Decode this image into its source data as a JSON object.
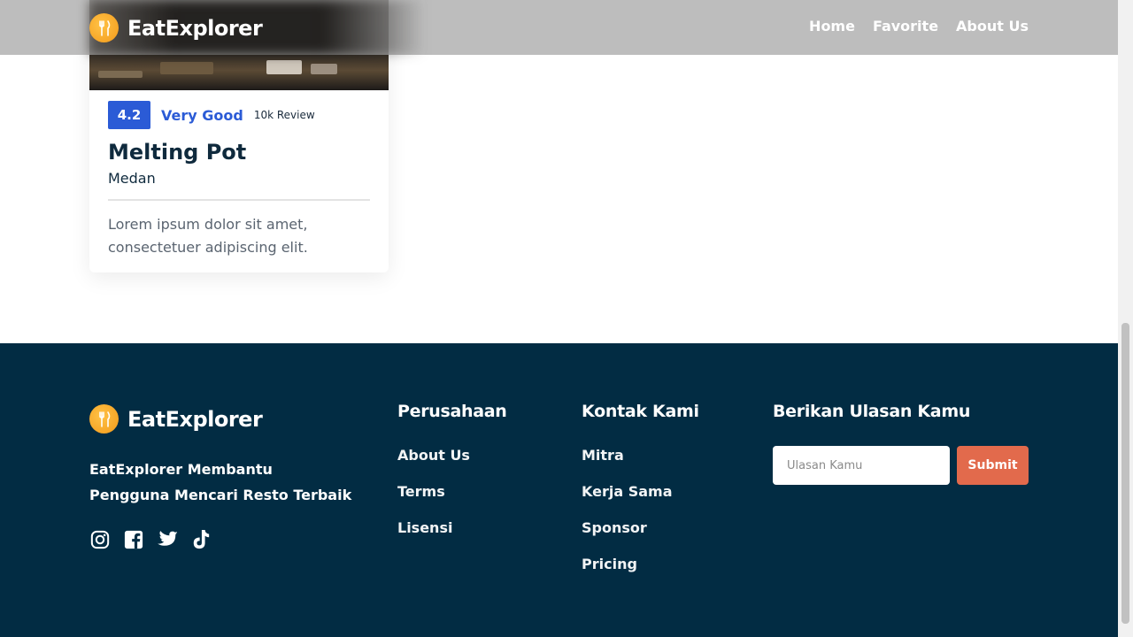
{
  "navbar": {
    "brand": "EatExplorer",
    "links": [
      "Home",
      "Favorite",
      "About Us"
    ]
  },
  "card": {
    "rating": "4.2",
    "rating_label": "Very Good",
    "review_count": "10k Review",
    "name": "Melting Pot",
    "city": "Medan",
    "description": "Lorem ipsum dolor sit amet, consectetuer adipiscing elit."
  },
  "footer": {
    "brand": "EatExplorer",
    "tagline": "EatExplorer Membantu Pengguna Mencari Resto Terbaik",
    "socials": [
      "instagram-icon",
      "facebook-icon",
      "twitter-icon",
      "tiktok-icon"
    ],
    "company": {
      "title": "Perusahaan",
      "links": [
        "About Us",
        "Terms",
        "Lisensi"
      ]
    },
    "contact": {
      "title": "Kontak Kami",
      "links": [
        "Mitra",
        "Kerja Sama",
        "Sponsor",
        "Pricing"
      ]
    },
    "review": {
      "title": "Berikan Ulasan Kamu",
      "placeholder": "Ulasan Kamu",
      "submit_label": "Submit"
    }
  },
  "colors": {
    "footer_bg": "#022c43",
    "accent_blue": "#2b5bd6",
    "submit": "#e26a4c",
    "logo": "#f39a1a"
  }
}
